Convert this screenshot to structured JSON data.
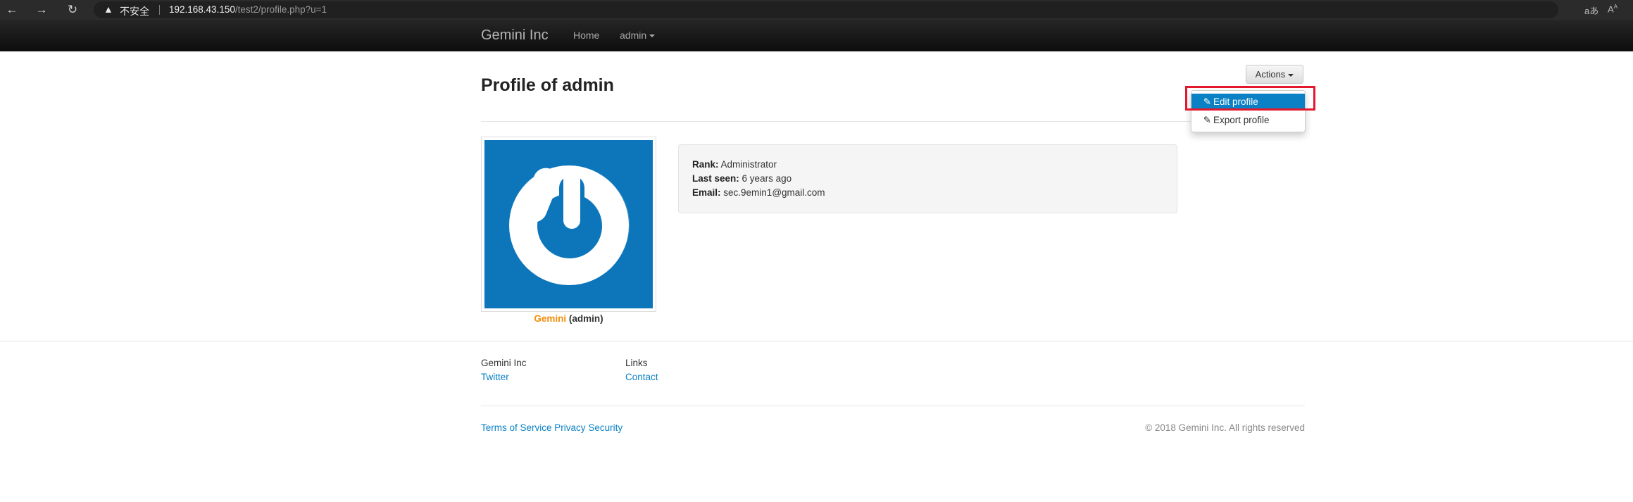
{
  "browser": {
    "back_icon": "back-arrow-icon",
    "forward_icon": "forward-arrow-icon",
    "reload_icon": "reload-icon",
    "warning_icon": "warning-icon",
    "insecure_label": "不安全",
    "url_host": "192.168.43.150",
    "url_path": "/test2/profile.php?u=1",
    "read_aloud_icon": "read-aloud-icon",
    "text_size_icon": "text-size-icon"
  },
  "navbar": {
    "brand": "Gemini Inc",
    "home": "Home",
    "user": "admin"
  },
  "profile": {
    "title": "Profile of admin",
    "avatar_name": "Gemini",
    "avatar_role": "(admin)",
    "rank_label": "Rank:",
    "rank_value": "Administrator",
    "last_seen_label": "Last seen:",
    "last_seen_value": "6 years ago",
    "email_label": "Email:",
    "email_value": "sec.9emin1@gmail.com"
  },
  "actions": {
    "label": "Actions",
    "items": [
      {
        "label": "Edit profile",
        "icon": "pencil-icon",
        "active": true
      },
      {
        "label": "Export profile",
        "icon": "pencil-icon",
        "active": false
      }
    ]
  },
  "footer": {
    "company": "Gemini Inc",
    "twitter": "Twitter",
    "links_heading": "Links",
    "contact": "Contact",
    "terms": "Terms of Service",
    "privacy": "Privacy",
    "security": "Security",
    "copyright": "© 2018 Gemini Inc. All rights reserved"
  },
  "colors": {
    "accent": "#0a81c4",
    "avatar_bg": "#0d76bb",
    "highlight": "#e3182d",
    "name_orange": "#f28e0c"
  }
}
